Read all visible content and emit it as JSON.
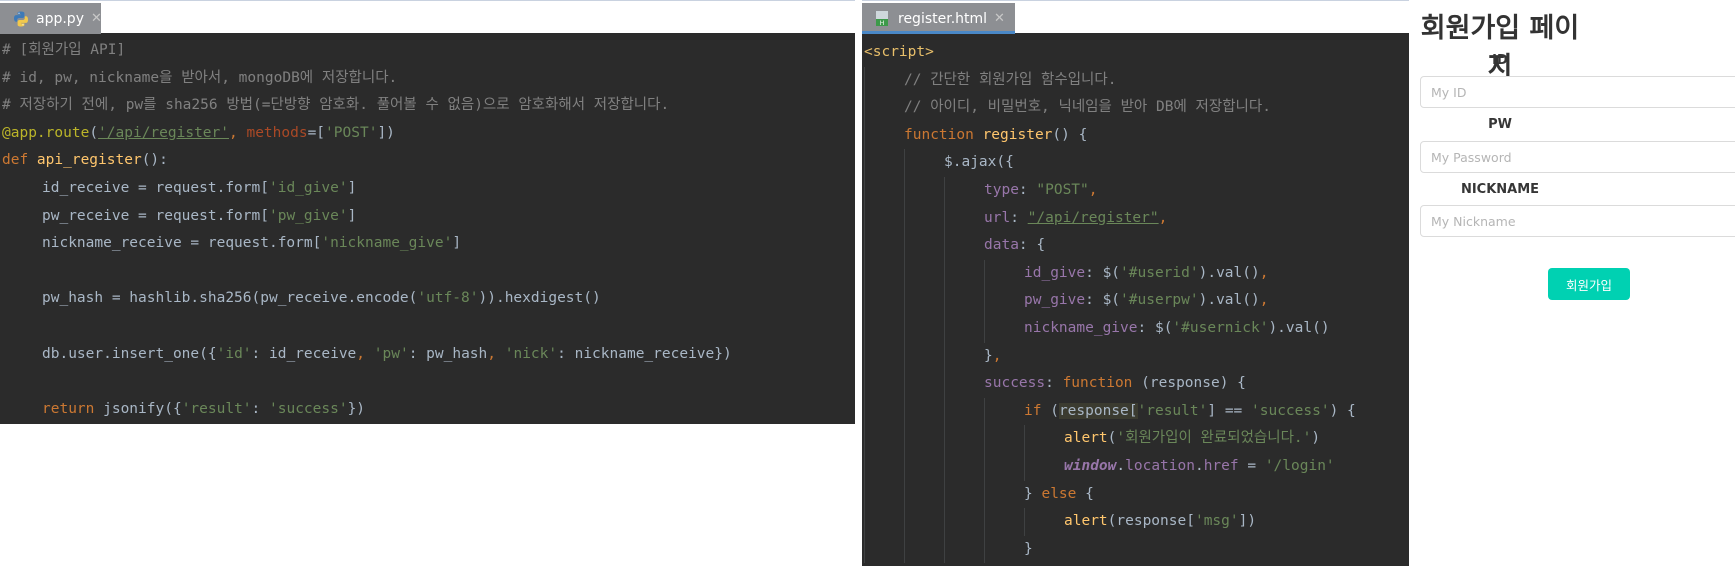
{
  "tabs": {
    "python_file": "app.py",
    "html_file": "register.html"
  },
  "python_code": [
    [
      [
        "tk-comment",
        "# [회원가입 API]"
      ]
    ],
    [
      [
        "tk-comment",
        "# id, pw, nickname을 받아서, mongoDB에 저장합니다."
      ]
    ],
    [
      [
        "tk-comment",
        "# 저장하기 전에, pw를 sha256 방법(=단방향 암호화. 풀어볼 수 없음)으로 암호화해서 저장합니다."
      ]
    ],
    [
      [
        "tk-deco",
        "@app.route"
      ],
      [
        "tk-plain",
        "("
      ],
      [
        "tk-link",
        "'/api/register'"
      ],
      [
        "tk-keyword",
        ", "
      ],
      [
        "tk-param",
        "methods"
      ],
      [
        "tk-plain",
        "=["
      ],
      [
        "tk-string",
        "'POST'"
      ],
      [
        "tk-plain",
        "])"
      ]
    ],
    [
      [
        "tk-keyword",
        "def "
      ],
      [
        "tk-func",
        "api_register"
      ],
      [
        "tk-plain",
        "():"
      ]
    ],
    [
      [
        "ind",
        ""
      ],
      [
        "tk-plain",
        "id_receive = request.form["
      ],
      [
        "tk-string",
        "'id_give'"
      ],
      [
        "tk-plain",
        "]"
      ]
    ],
    [
      [
        "ind",
        ""
      ],
      [
        "tk-plain",
        "pw_receive = request.form["
      ],
      [
        "tk-string",
        "'pw_give'"
      ],
      [
        "tk-plain",
        "]"
      ]
    ],
    [
      [
        "ind",
        ""
      ],
      [
        "tk-plain",
        "nickname_receive = request.form["
      ],
      [
        "tk-string",
        "'nickname_give'"
      ],
      [
        "tk-plain",
        "]"
      ]
    ],
    [],
    [
      [
        "ind",
        ""
      ],
      [
        "tk-plain",
        "pw_hash = hashlib.sha256(pw_receive.encode("
      ],
      [
        "tk-string",
        "'utf-8'"
      ],
      [
        "tk-plain",
        ")).hexdigest()"
      ]
    ],
    [],
    [
      [
        "ind",
        ""
      ],
      [
        "tk-plain",
        "db.user.insert_one({"
      ],
      [
        "tk-string",
        "'id'"
      ],
      [
        "tk-plain",
        ": id_receive"
      ],
      [
        "tk-keyword",
        ", "
      ],
      [
        "tk-string",
        "'pw'"
      ],
      [
        "tk-plain",
        ": pw_hash"
      ],
      [
        "tk-keyword",
        ", "
      ],
      [
        "tk-string",
        "'nick'"
      ],
      [
        "tk-plain",
        ": nickname_receive})"
      ]
    ],
    [],
    [
      [
        "ind",
        ""
      ],
      [
        "tk-keyword",
        "return "
      ],
      [
        "tk-plain",
        "jsonify({"
      ],
      [
        "tk-string",
        "'result'"
      ],
      [
        "tk-plain",
        ": "
      ],
      [
        "tk-string",
        "'success'"
      ],
      [
        "tk-plain",
        "})"
      ]
    ]
  ],
  "html_code": [
    [
      [
        "tk-tag",
        "<script>"
      ]
    ],
    [
      [
        "ind",
        ""
      ],
      [
        "tk-comment",
        "// 간단한 회원가입 함수입니다."
      ]
    ],
    [
      [
        "ind",
        ""
      ],
      [
        "tk-comment",
        "// 아이디, 비밀번호, 닉네임을 받아 DB에 저장합니다."
      ]
    ],
    [
      [
        "ind",
        ""
      ],
      [
        "tk-keyword",
        "function "
      ],
      [
        "tk-func",
        "register"
      ],
      [
        "tk-plain",
        "() {"
      ]
    ],
    [
      [
        "ind",
        ""
      ],
      [
        "ind",
        ""
      ],
      [
        "tk-plain",
        "$.ajax({"
      ]
    ],
    [
      [
        "ind",
        ""
      ],
      [
        "ind",
        ""
      ],
      [
        "ind",
        ""
      ],
      [
        "tk-prop",
        "type"
      ],
      [
        "tk-plain",
        ": "
      ],
      [
        "tk-string",
        "\"POST\""
      ],
      [
        "tk-keyword",
        ","
      ]
    ],
    [
      [
        "ind",
        ""
      ],
      [
        "ind",
        ""
      ],
      [
        "ind",
        ""
      ],
      [
        "tk-prop",
        "url"
      ],
      [
        "tk-plain",
        ": "
      ],
      [
        "tk-link",
        "\"/api/register\""
      ],
      [
        "tk-keyword",
        ","
      ]
    ],
    [
      [
        "ind",
        ""
      ],
      [
        "ind",
        ""
      ],
      [
        "ind",
        ""
      ],
      [
        "tk-prop",
        "data"
      ],
      [
        "tk-plain",
        ": {"
      ]
    ],
    [
      [
        "ind",
        ""
      ],
      [
        "ind",
        ""
      ],
      [
        "ind",
        ""
      ],
      [
        "ind",
        ""
      ],
      [
        "tk-prop",
        "id_give"
      ],
      [
        "tk-plain",
        ": $("
      ],
      [
        "tk-string",
        "'#userid'"
      ],
      [
        "tk-plain",
        ").val()"
      ],
      [
        "tk-keyword",
        ","
      ]
    ],
    [
      [
        "ind",
        ""
      ],
      [
        "ind",
        ""
      ],
      [
        "ind",
        ""
      ],
      [
        "ind",
        ""
      ],
      [
        "tk-prop",
        "pw_give"
      ],
      [
        "tk-plain",
        ": $("
      ],
      [
        "tk-string",
        "'#userpw'"
      ],
      [
        "tk-plain",
        ").val()"
      ],
      [
        "tk-keyword",
        ","
      ]
    ],
    [
      [
        "ind",
        ""
      ],
      [
        "ind",
        ""
      ],
      [
        "ind",
        ""
      ],
      [
        "ind",
        ""
      ],
      [
        "tk-prop",
        "nickname_give"
      ],
      [
        "tk-plain",
        ": $("
      ],
      [
        "tk-string",
        "'#usernick'"
      ],
      [
        "tk-plain",
        ").val()"
      ]
    ],
    [
      [
        "ind",
        ""
      ],
      [
        "ind",
        ""
      ],
      [
        "ind",
        ""
      ],
      [
        "tk-plain",
        "}"
      ],
      [
        "tk-keyword",
        ","
      ]
    ],
    [
      [
        "ind",
        ""
      ],
      [
        "ind",
        ""
      ],
      [
        "ind",
        ""
      ],
      [
        "tk-prop",
        "success"
      ],
      [
        "tk-plain",
        ": "
      ],
      [
        "tk-keyword",
        "function "
      ],
      [
        "tk-plain",
        "(response) {"
      ]
    ],
    [
      [
        "ind",
        ""
      ],
      [
        "ind",
        ""
      ],
      [
        "ind",
        ""
      ],
      [
        "ind",
        ""
      ],
      [
        "tk-keyword",
        "if "
      ],
      [
        "tk-plain",
        "("
      ],
      [
        "tk-hl",
        "response["
      ],
      [
        "tk-string",
        "'result'"
      ],
      [
        "tk-plain",
        "] == "
      ],
      [
        "tk-string",
        "'success'"
      ],
      [
        "tk-plain",
        ") {"
      ]
    ],
    [
      [
        "ind",
        ""
      ],
      [
        "ind",
        ""
      ],
      [
        "ind",
        ""
      ],
      [
        "ind",
        ""
      ],
      [
        "ind",
        ""
      ],
      [
        "tk-func",
        "alert"
      ],
      [
        "tk-plain",
        "("
      ],
      [
        "tk-string",
        "'회원가입이 완료되었습니다.'"
      ],
      [
        "tk-plain",
        ")"
      ]
    ],
    [
      [
        "ind",
        ""
      ],
      [
        "ind",
        ""
      ],
      [
        "ind",
        ""
      ],
      [
        "ind",
        ""
      ],
      [
        "ind",
        ""
      ],
      [
        "tk-window",
        "window"
      ],
      [
        "tk-plain",
        "."
      ],
      [
        "tk-prop",
        "location"
      ],
      [
        "tk-plain",
        "."
      ],
      [
        "tk-prop",
        "href"
      ],
      [
        "tk-plain",
        " = "
      ],
      [
        "tk-string",
        "'/login'"
      ]
    ],
    [
      [
        "ind",
        ""
      ],
      [
        "ind",
        ""
      ],
      [
        "ind",
        ""
      ],
      [
        "ind",
        ""
      ],
      [
        "tk-plain",
        "} "
      ],
      [
        "tk-keyword",
        "else "
      ],
      [
        "tk-plain",
        "{"
      ]
    ],
    [
      [
        "ind",
        ""
      ],
      [
        "ind",
        ""
      ],
      [
        "ind",
        ""
      ],
      [
        "ind",
        ""
      ],
      [
        "ind",
        ""
      ],
      [
        "tk-func",
        "alert"
      ],
      [
        "tk-plain",
        "(response["
      ],
      [
        "tk-string",
        "'msg'"
      ],
      [
        "tk-plain",
        "])"
      ]
    ],
    [
      [
        "ind",
        ""
      ],
      [
        "ind",
        ""
      ],
      [
        "ind",
        ""
      ],
      [
        "ind",
        ""
      ],
      [
        "tk-plain",
        "}"
      ]
    ]
  ],
  "signup": {
    "title": "회원가입 페이지",
    "id_label": "ID",
    "id_placeholder": "My ID",
    "pw_label": "PW",
    "pw_placeholder": "My Password",
    "nickname_label": "NICKNAME",
    "nickname_placeholder": "My Nickname",
    "button_label": "회원가입"
  },
  "colors": {
    "editor_bg": "#2b2b2b",
    "tab_bg": "#8d8f93",
    "tab_active_underline": "#4a88c7",
    "button_bg": "#00d1b2"
  },
  "icons": {
    "python_tab": "python-file-icon",
    "html_tab": "html-file-icon",
    "tab_close": "close-icon"
  }
}
